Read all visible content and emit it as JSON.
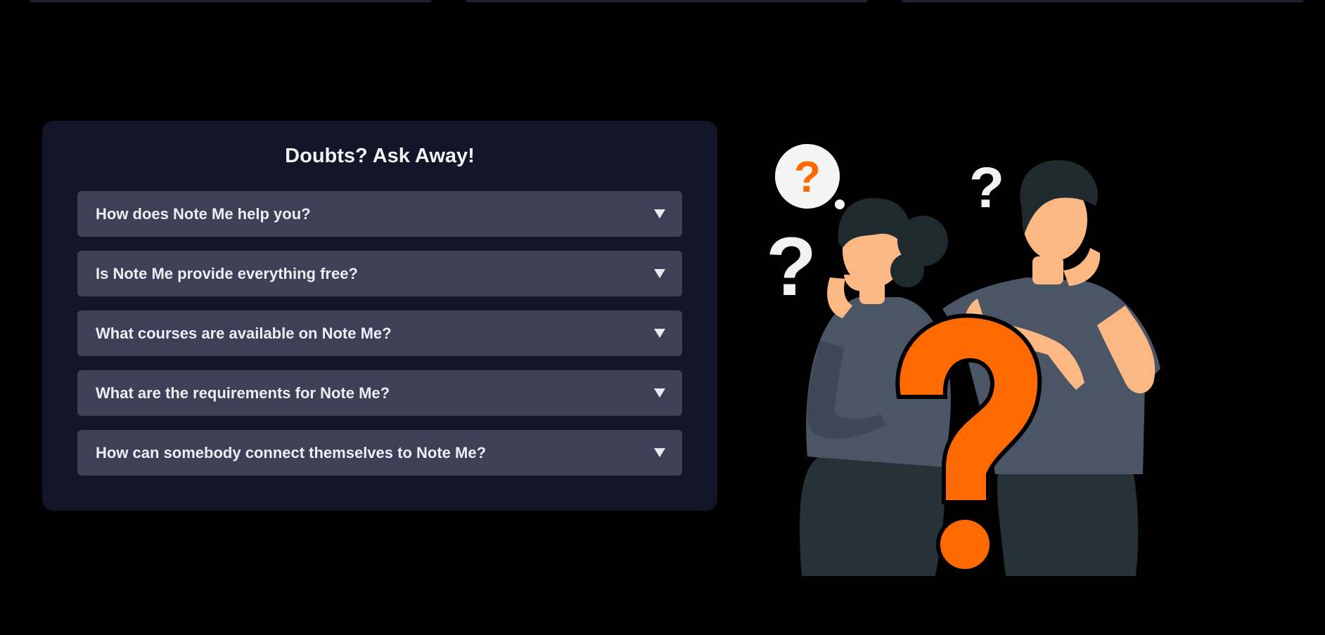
{
  "faq": {
    "title": "Doubts? Ask Away!",
    "items": [
      {
        "question": "How does Note Me help you?"
      },
      {
        "question": "Is Note Me provide everything free?"
      },
      {
        "question": "What courses are available on Note Me?"
      },
      {
        "question": "What are the requirements for Note Me?"
      },
      {
        "question": "How can somebody connect themselves to Note Me?"
      }
    ],
    "expand_icon": "caret-down-icon"
  },
  "illustration": {
    "subject": "two-people-wondering-with-question-marks",
    "colors": {
      "accent": "#ff6a00",
      "shirt": "#4a5566",
      "skin": "#fbb882",
      "hair": "#1f2a2e",
      "pants": "#263238"
    }
  }
}
